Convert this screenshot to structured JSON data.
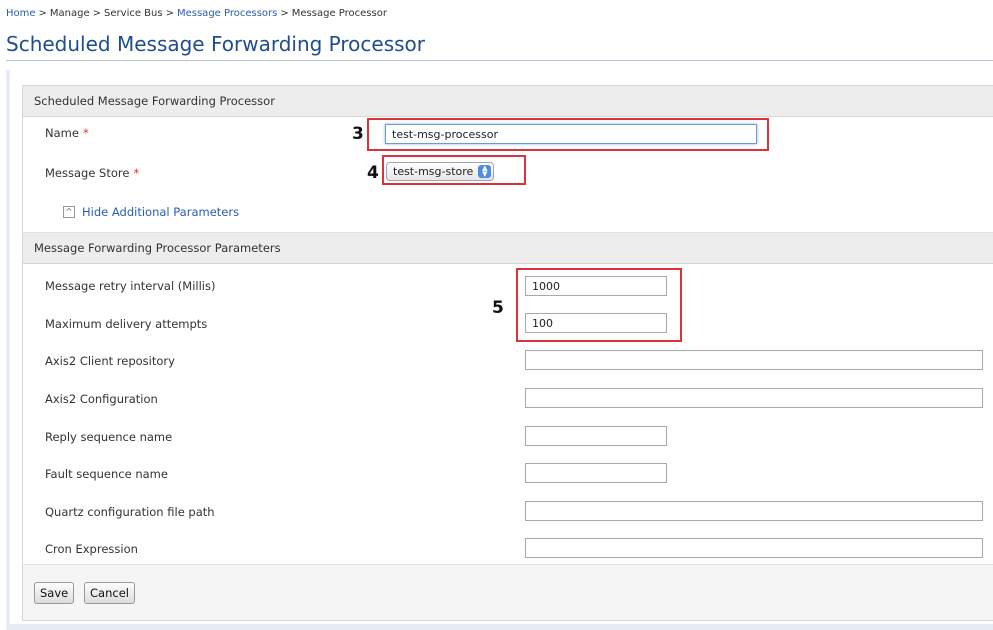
{
  "breadcrumb": {
    "home": "Home",
    "manage": "Manage",
    "service_bus": "Service Bus",
    "message_processors": "Message Processors",
    "current": "Message Processor",
    "separator": ">"
  },
  "page_title": "Scheduled Message Forwarding Processor",
  "form": {
    "section_title": "Scheduled Message Forwarding Processor",
    "name_label": "Name",
    "name_value": "test-msg-processor",
    "store_label": "Message Store",
    "store_value": "test-msg-store",
    "required_marker": "*",
    "toggle_label": "Hide Additional Parameters",
    "toggle_symbol": "^"
  },
  "params": {
    "section_title": "Message Forwarding Processor Parameters",
    "fields": [
      {
        "label": "Message retry interval (Millis)",
        "value": "1000"
      },
      {
        "label": "Maximum delivery attempts",
        "value": "100"
      },
      {
        "label": "Axis2 Client repository",
        "value": ""
      },
      {
        "label": "Axis2 Configuration",
        "value": ""
      },
      {
        "label": "Reply sequence name",
        "value": ""
      },
      {
        "label": "Fault sequence name",
        "value": ""
      },
      {
        "label": "Quartz configuration file path",
        "value": ""
      },
      {
        "label": "Cron Expression",
        "value": ""
      }
    ]
  },
  "annotations": {
    "step3": "3",
    "step4": "4",
    "step5": "5"
  },
  "buttons": {
    "save": "Save",
    "cancel": "Cancel"
  },
  "colors": {
    "title": "#1f4e8c",
    "link": "#2a5db0",
    "callout": "#d9343a",
    "required": "#dd3333"
  }
}
